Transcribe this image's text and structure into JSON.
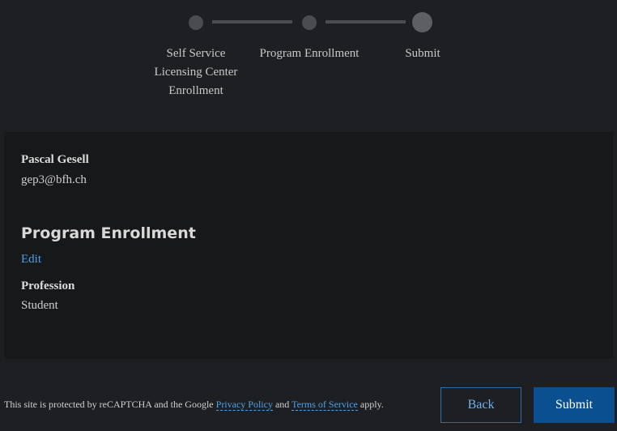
{
  "stepper": {
    "steps": [
      {
        "label_lines": [
          "Self Service",
          "Licensing Center",
          "Enrollment"
        ]
      },
      {
        "label_lines": [
          "Program Enrollment"
        ]
      },
      {
        "label_lines": [
          "Submit"
        ]
      }
    ]
  },
  "profile": {
    "name": "Pascal Gesell",
    "email": "gep3@bfh.ch"
  },
  "program": {
    "section_title": "Program Enrollment",
    "edit_label": "Edit",
    "profession_label": "Profession",
    "profession_value": "Student"
  },
  "footer": {
    "text_prefix": "This site is protected by reCAPTCHA and the Google ",
    "privacy_link": "Privacy Policy",
    "text_and": " and ",
    "terms_link": "Terms of Service",
    "text_suffix": " apply."
  },
  "buttons": {
    "back_label": "Back",
    "submit_label": "Submit"
  },
  "colors": {
    "background": "#1d1f22",
    "card": "#17181a",
    "link": "#4aa3f0",
    "primary": "#0a4f8f"
  }
}
